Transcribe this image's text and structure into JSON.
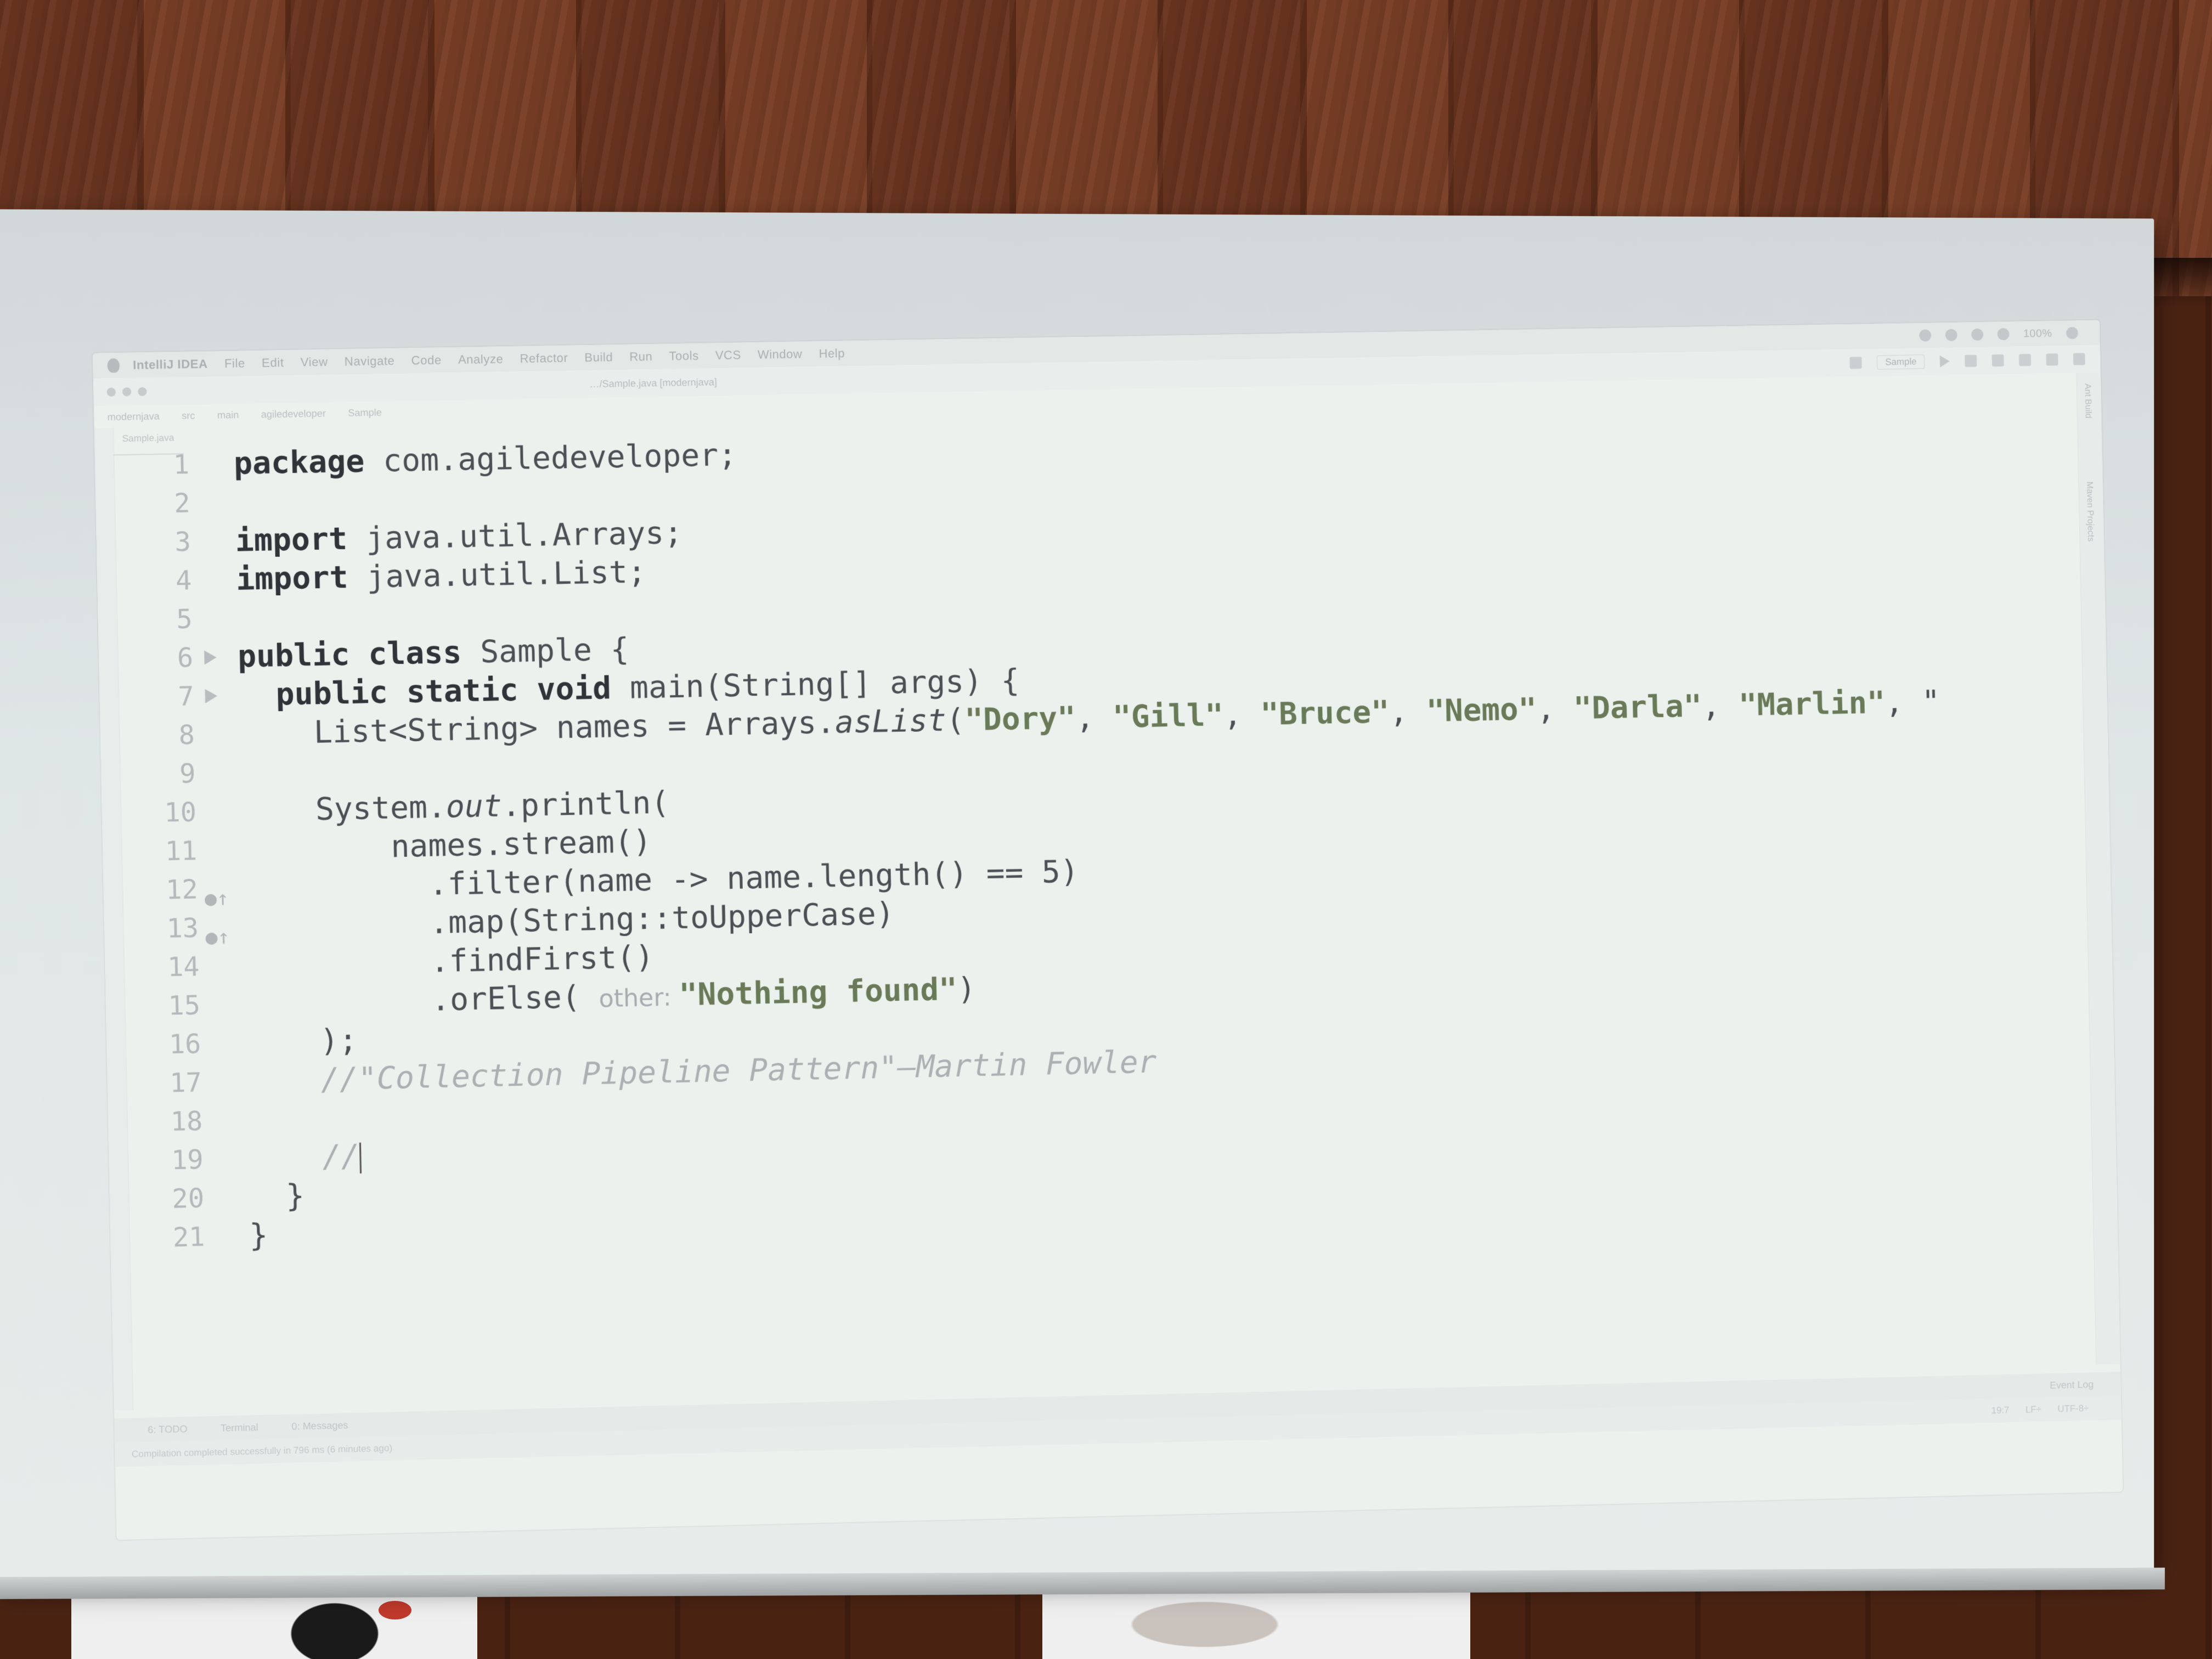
{
  "menubar": {
    "app_name": "IntelliJ IDEA",
    "items": [
      "File",
      "Edit",
      "View",
      "Navigate",
      "Code",
      "Analyze",
      "Refactor",
      "Build",
      "Run",
      "Tools",
      "VCS",
      "Window",
      "Help"
    ],
    "battery": "100%"
  },
  "toolbar": {
    "title_path": "…/Sample.java [modernjava]",
    "run_config": "Sample"
  },
  "breadcrumbs": [
    "modernjava",
    "src",
    "main",
    "agiledeveloper",
    "Sample"
  ],
  "editor_tab": "Sample.java",
  "right_tool_windows": [
    "Ant Build",
    "Maven Projects"
  ],
  "code": {
    "lines": [
      {
        "n": "1",
        "parts": [
          {
            "t": "package",
            "c": "kw"
          },
          {
            "t": " com.agiledeveloper;"
          }
        ]
      },
      {
        "n": "2",
        "parts": []
      },
      {
        "n": "3",
        "parts": [
          {
            "t": "import",
            "c": "kw"
          },
          {
            "t": " java.util.Arrays;"
          }
        ]
      },
      {
        "n": "4",
        "parts": [
          {
            "t": "import",
            "c": "kw"
          },
          {
            "t": " java.util.List;"
          }
        ]
      },
      {
        "n": "5",
        "parts": []
      },
      {
        "n": "6",
        "run": true,
        "parts": [
          {
            "t": "public class",
            "c": "kw"
          },
          {
            "t": " Sample {"
          }
        ]
      },
      {
        "n": "7",
        "run": true,
        "parts": [
          {
            "t": "  "
          },
          {
            "t": "public static void",
            "c": "kw"
          },
          {
            "t": " main(String[] args) {"
          }
        ]
      },
      {
        "n": "8",
        "parts": [
          {
            "t": "    List<String> names = Arrays."
          },
          {
            "t": "asList",
            "c": "it"
          },
          {
            "t": "("
          },
          {
            "t": "\"Dory\"",
            "c": "str"
          },
          {
            "t": ", "
          },
          {
            "t": "\"Gill\"",
            "c": "str"
          },
          {
            "t": ", "
          },
          {
            "t": "\"Bruce\"",
            "c": "str"
          },
          {
            "t": ", "
          },
          {
            "t": "\"Nemo\"",
            "c": "str"
          },
          {
            "t": ", "
          },
          {
            "t": "\"Darla\"",
            "c": "str"
          },
          {
            "t": ", "
          },
          {
            "t": "\"Marlin\"",
            "c": "str"
          },
          {
            "t": ", \""
          }
        ]
      },
      {
        "n": "9",
        "parts": []
      },
      {
        "n": "10",
        "parts": [
          {
            "t": "    System."
          },
          {
            "t": "out",
            "c": "it"
          },
          {
            "t": ".println("
          }
        ]
      },
      {
        "n": "11",
        "parts": [
          {
            "t": "        names.stream()"
          }
        ]
      },
      {
        "n": "12",
        "override": true,
        "parts": [
          {
            "t": "          .filter(name -> name.length() == 5)"
          }
        ]
      },
      {
        "n": "13",
        "override": true,
        "parts": [
          {
            "t": "          .map(String::toUpperCase)"
          }
        ]
      },
      {
        "n": "14",
        "parts": [
          {
            "t": "          .findFirst()"
          }
        ]
      },
      {
        "n": "15",
        "parts": [
          {
            "t": "          .orElse( "
          },
          {
            "t": "other: ",
            "c": "hint"
          },
          {
            "t": "\"Nothing found\"",
            "c": "str"
          },
          {
            "t": ")"
          }
        ]
      },
      {
        "n": "16",
        "parts": [
          {
            "t": "    );"
          }
        ]
      },
      {
        "n": "17",
        "parts": [
          {
            "t": "    //\"Collection Pipeline Pattern\"—Martin Fowler",
            "c": "comment"
          }
        ]
      },
      {
        "n": "18",
        "parts": []
      },
      {
        "n": "19",
        "caret": true,
        "parts": [
          {
            "t": "    //",
            "c": "comment"
          }
        ]
      },
      {
        "n": "20",
        "parts": [
          {
            "t": "  }"
          }
        ]
      },
      {
        "n": "21",
        "parts": [
          {
            "t": "}"
          }
        ]
      }
    ]
  },
  "bottom_tools": [
    "6: TODO",
    "Terminal",
    "0: Messages",
    "Event Log"
  ],
  "statusbar": {
    "message": "Compilation completed successfully in 796 ms (6 minutes ago)",
    "position": "19:7",
    "line_sep": "LF÷",
    "encoding": "UTF-8÷"
  }
}
